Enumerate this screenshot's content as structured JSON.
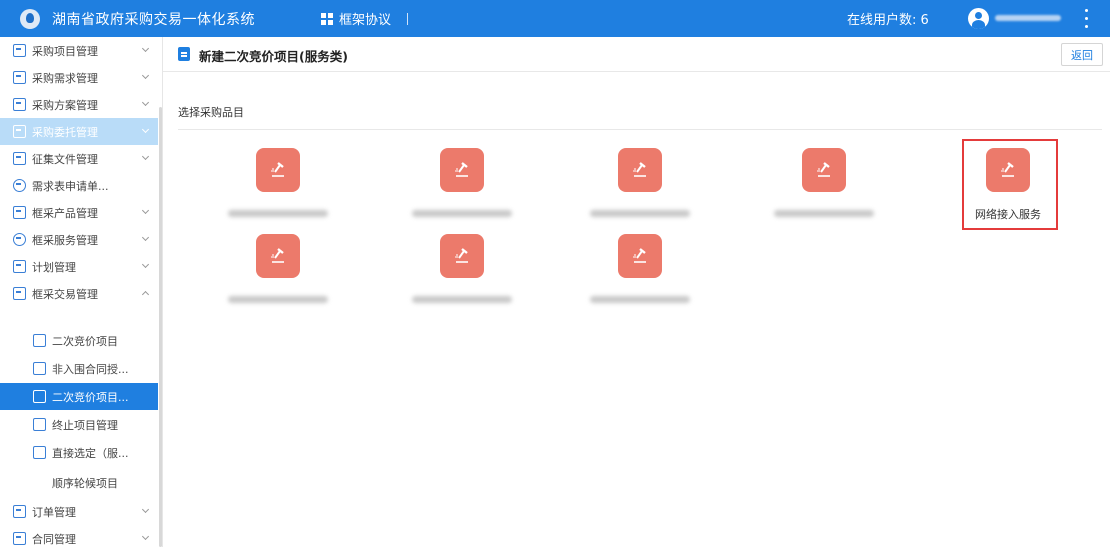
{
  "header": {
    "app_title": "湖南省政府采购交易一体化系统",
    "menu_tab": "框架协议",
    "online_label": "在线用户数: 6",
    "colors": {
      "bar": "#1f7fe0"
    }
  },
  "sidebar": {
    "items": [
      {
        "label": "采购项目管理",
        "icon": "folder-icon"
      },
      {
        "label": "采购需求管理",
        "icon": "form-icon"
      },
      {
        "label": "采购方案管理",
        "icon": "form-icon"
      },
      {
        "label": "采购委托管理",
        "icon": "form-icon"
      },
      {
        "label": "征集文件管理",
        "icon": "doc-icon"
      },
      {
        "label": "需求表申请单...",
        "icon": "user-icon"
      },
      {
        "label": "框采产品管理",
        "icon": "doc-icon"
      },
      {
        "label": "框采服务管理",
        "icon": "heart-icon"
      },
      {
        "label": "计划管理",
        "icon": "calendar-icon"
      },
      {
        "label": "框采交易管理",
        "icon": "folder-icon"
      }
    ],
    "sub_items": [
      {
        "label": "二次竞价项目"
      },
      {
        "label": "非入围合同授..."
      },
      {
        "label": "二次竞价项目..."
      },
      {
        "label": "终止项目管理"
      },
      {
        "label": "直接选定（服..."
      },
      {
        "label": "顺序轮候项目"
      }
    ],
    "bottom_items": [
      {
        "label": "订单管理"
      },
      {
        "label": "合同管理"
      }
    ]
  },
  "main": {
    "page_title": "新建二次竞价项目(服务类)",
    "back_label": "返回",
    "section_label": "选择采购品目",
    "categories": [
      {
        "name": "",
        "icon": "gavel-icon",
        "blurred": true
      },
      {
        "name": "",
        "icon": "gavel-icon",
        "blurred": true
      },
      {
        "name": "",
        "icon": "gavel-icon",
        "blurred": true
      },
      {
        "name": "",
        "icon": "gavel-icon",
        "blurred": true
      },
      {
        "name": "网络接入服务",
        "icon": "gavel-icon",
        "blurred": false,
        "selected": true
      },
      {
        "name": "",
        "icon": "gavel-icon",
        "blurred": true
      },
      {
        "name": "",
        "icon": "gavel-icon",
        "blurred": true
      },
      {
        "name": "",
        "icon": "gavel-icon",
        "blurred": true
      }
    ],
    "colors": {
      "tile": "#ec7a6b",
      "highlight": "#e43b3b"
    }
  }
}
